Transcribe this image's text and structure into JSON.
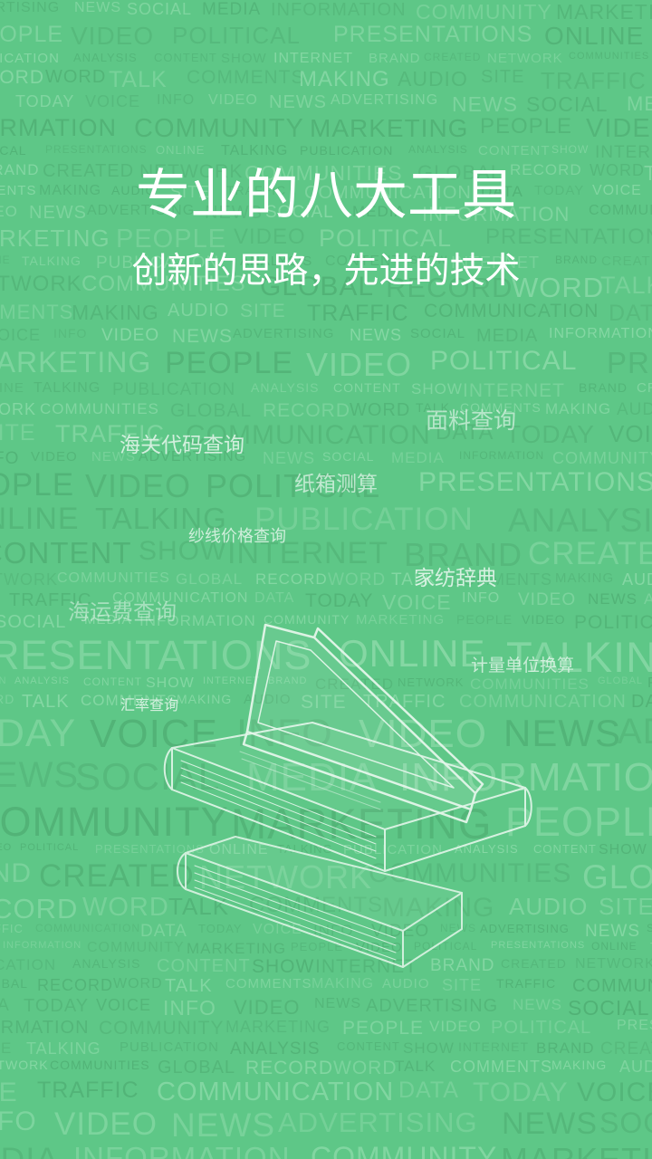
{
  "splash": {
    "title": "专业的八大工具",
    "subtitle": "创新的思路，先进的技术"
  },
  "tools": [
    {
      "label": "面料查询"
    },
    {
      "label": "海关代码查询"
    },
    {
      "label": "纸箱测算"
    },
    {
      "label": "纱线价格查询"
    },
    {
      "label": "家纺辞典"
    },
    {
      "label": "海运费查询"
    },
    {
      "label": "计量单位换算"
    },
    {
      "label": "汇率查询"
    }
  ],
  "background_words": [
    "ADVERTISING",
    "NEWS",
    "SOCIAL",
    "MEDIA",
    "INFORMATION",
    "COMMUNITY",
    "MARKETING",
    "PEOPLE",
    "VIDEO",
    "POLITICAL",
    "PRESENTATIONS",
    "ONLINE",
    "TALKING",
    "PUBLICATION",
    "ANALYSIS",
    "CONTENT",
    "SHOW",
    "INTERNET",
    "BRAND",
    "CREATED",
    "NETWORK",
    "COMMUNITIES",
    "GLOBAL",
    "RECORD",
    "WORD",
    "TALK",
    "COMMENTS",
    "MAKING",
    "AUDIO",
    "SITE",
    "TRAFFIC",
    "COMMUNICATION",
    "DATA",
    "TODAY",
    "VOICE",
    "INFO",
    "VIDEO",
    "NEWS"
  ],
  "colors": {
    "background": "#5ec787",
    "word_light": "#8fdcab",
    "word_dark": "#4fae73",
    "headline": "#ffffff",
    "tool_text": "#e9f7ee",
    "book_line": "#e4f6ea"
  },
  "icons": {
    "illustration": "stacked-books-icon"
  }
}
